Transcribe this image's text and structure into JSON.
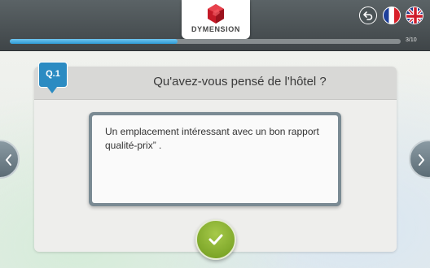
{
  "header": {
    "brand": "DYMENSION",
    "icons": {
      "logo": "red-cube-logo-icon",
      "back": "back-arrow-icon",
      "french": "french-flag-icon",
      "english": "uk-flag-icon"
    }
  },
  "progress": {
    "label": "3/10",
    "fraction": 0.43
  },
  "question": {
    "badge": "Q.1",
    "text": "Qu'avez-vous pensé de l'hôtel ?",
    "answer": "Un emplacement intéressant avec un bon rapport qualité-prix” ."
  },
  "navigation": {
    "prev_icon": "chevron-left-icon",
    "next_icon": "chevron-right-icon",
    "validate_icon": "checkmark-icon"
  },
  "colors": {
    "accent": "#2b8bc2",
    "validate": "#86ad2c",
    "logo_red": "#d01f2e"
  }
}
